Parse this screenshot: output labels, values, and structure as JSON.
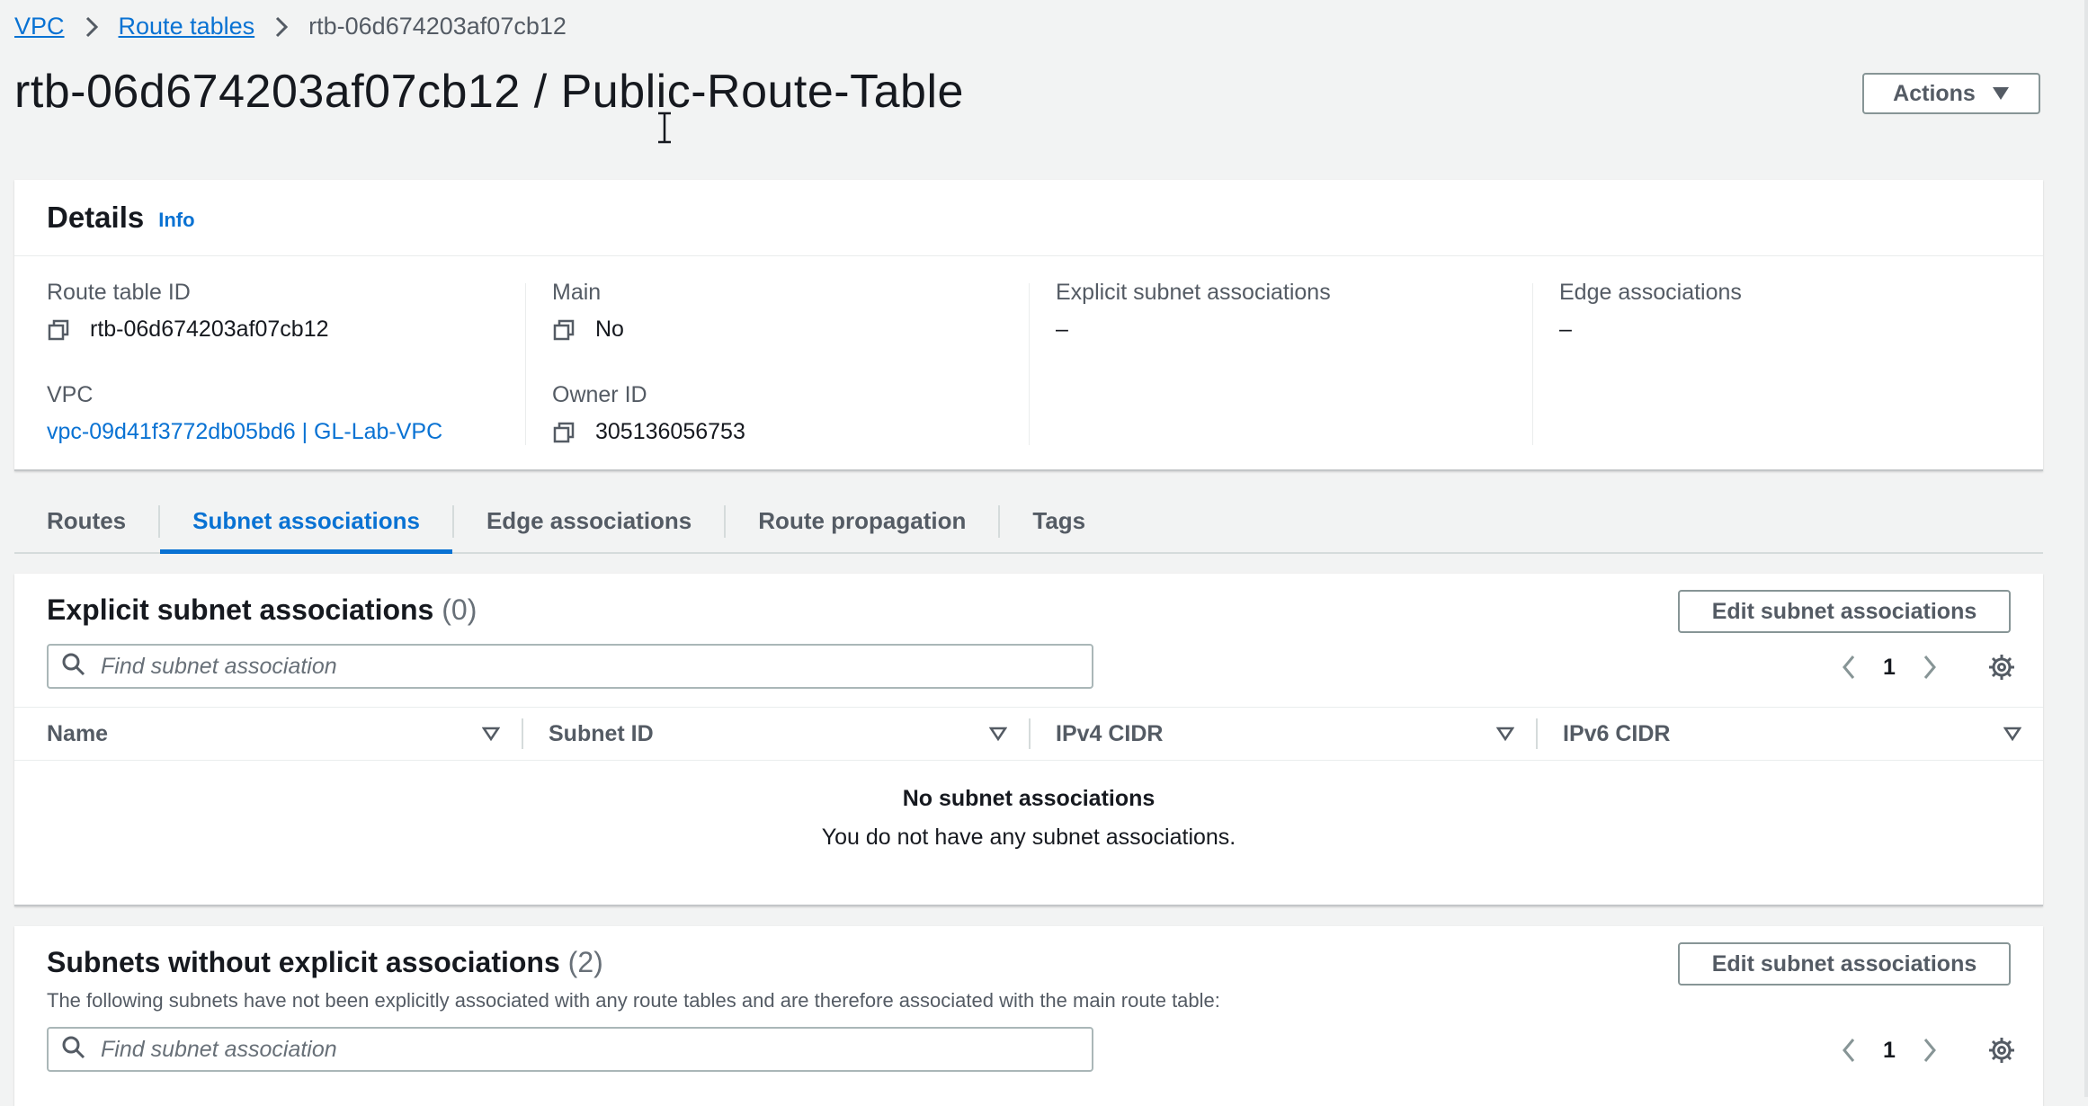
{
  "breadcrumb": {
    "items": [
      {
        "label": "VPC"
      },
      {
        "label": "Route tables"
      }
    ],
    "current": "rtb-06d674203af07cb12"
  },
  "page": {
    "title": "rtb-06d674203af07cb12 / Public-Route-Table",
    "actions_label": "Actions"
  },
  "details": {
    "title": "Details",
    "info": "Info",
    "route_table_id": {
      "label": "Route table ID",
      "value": "rtb-06d674203af07cb12"
    },
    "vpc": {
      "label": "VPC",
      "value": "vpc-09d41f3772db05bd6 | GL-Lab-VPC"
    },
    "main": {
      "label": "Main",
      "value": "No"
    },
    "owner_id": {
      "label": "Owner ID",
      "value": "305136056753"
    },
    "explicit_subnet_associations": {
      "label": "Explicit subnet associations",
      "value": "–"
    },
    "edge_associations": {
      "label": "Edge associations",
      "value": "–"
    }
  },
  "tabs": [
    {
      "label": "Routes",
      "active": false
    },
    {
      "label": "Subnet associations",
      "active": true
    },
    {
      "label": "Edge associations",
      "active": false
    },
    {
      "label": "Route propagation",
      "active": false
    },
    {
      "label": "Tags",
      "active": false
    }
  ],
  "explicit_panel": {
    "title": "Explicit subnet associations",
    "count": "(0)",
    "edit_label": "Edit subnet associations",
    "search_placeholder": "Find subnet association",
    "page": "1",
    "columns": [
      "Name",
      "Subnet ID",
      "IPv4 CIDR",
      "IPv6 CIDR"
    ],
    "empty_title": "No subnet associations",
    "empty_desc": "You do not have any subnet associations."
  },
  "implicit_panel": {
    "title": "Subnets without explicit associations",
    "count": "(2)",
    "description": "The following subnets have not been explicitly associated with any route tables and are therefore associated with the main route table:",
    "edit_label": "Edit subnet associations",
    "search_placeholder": "Find subnet association",
    "page": "1"
  },
  "icons": {
    "breadcrumb_separator": "chevron-right-icon",
    "copy": "copy-icon",
    "search": "search-icon",
    "settings": "gear-icon",
    "caret": "caret-down-icon",
    "filter": "sort-triangle-icon"
  },
  "colors": {
    "link": "#0972d3",
    "background": "#f2f3f3",
    "text": "#16191f",
    "muted": "#545b64"
  }
}
